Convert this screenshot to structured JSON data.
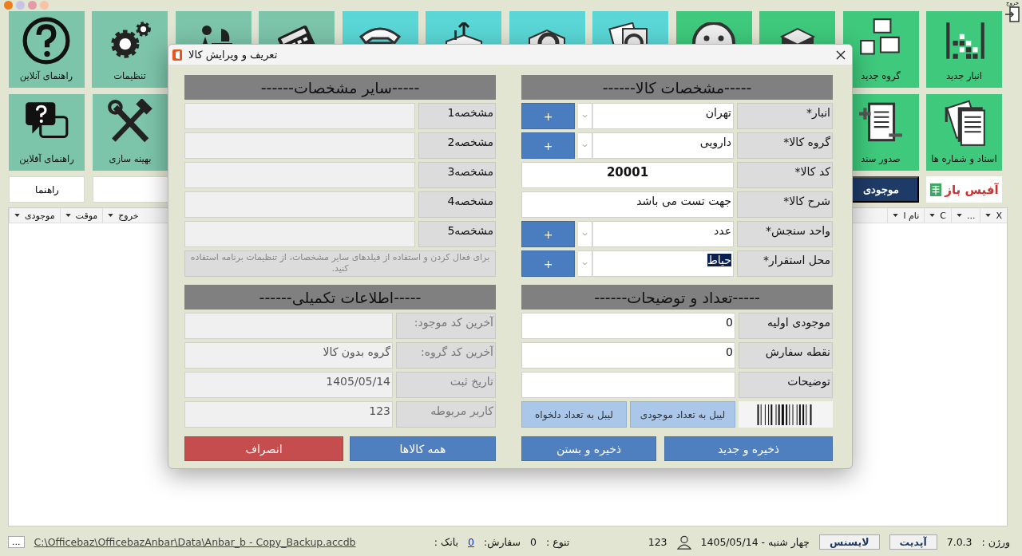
{
  "window_dots": [
    {
      "color": "#f07c1c"
    },
    {
      "color": "#c9c3e8"
    },
    {
      "color": "#e59aa8"
    },
    {
      "color": "#f6c3a8"
    }
  ],
  "exit": {
    "label": "خروج"
  },
  "top_tiles": [
    {
      "label": "انبار جدید",
      "color": "#3ec97c"
    },
    {
      "label": "گروه جدید",
      "color": "#3ec97c"
    },
    {
      "color": "#3ec97c"
    },
    {
      "color": "#3ec97c"
    },
    {
      "color": "#5ad6d6"
    },
    {
      "color": "#5ad6d6"
    },
    {
      "color": "#5ad6d6"
    },
    {
      "color": "#5ad6d6"
    },
    {
      "color": "#7cc4aa"
    },
    {
      "color": "#7cc4aa"
    },
    {
      "label": "تنظیمات",
      "color": "#7cc4aa"
    },
    {
      "label": "راهنمای آنلاین",
      "color": "#7cc4aa"
    }
  ],
  "second_row": {
    "right": [
      {
        "label": "اسناد و شماره ها",
        "color": "#3ec97c"
      },
      {
        "label": "صدور سند",
        "color": "#3ec97c"
      }
    ],
    "left": [
      {
        "label": "بهینه سازی",
        "color": "#7cc4aa"
      },
      {
        "label": "راهنمای آفلاین",
        "color": "#7cc4aa"
      }
    ]
  },
  "third_row": {
    "logo": "آفیس باز",
    "stock_button": "موجودی",
    "help_button": "راهنما"
  },
  "grid_header": {
    "right_columns": [
      "X",
      "...",
      "C",
      "نام ا"
    ],
    "left_columns": [
      "خروج",
      "موقت",
      "موجودی"
    ]
  },
  "dialog": {
    "title": "تعریف و ویرایش کالا",
    "sections": [
      {
        "title": "-----مشخصات کالا------",
        "rows": [
          {
            "kind": "combo",
            "label": "انبار*",
            "value": "تهران",
            "highlighted": false,
            "button": "+"
          },
          {
            "kind": "combo",
            "label": "گروه کالا*",
            "value": "دارویی",
            "highlighted": false,
            "button": "+"
          },
          {
            "kind": "code",
            "label": "کد کالا*",
            "value": "20001"
          },
          {
            "kind": "text",
            "label": "شرح کالا*",
            "value": "جهت تست می باشد",
            "disabled": false
          },
          {
            "kind": "combo",
            "label": "واحد سنجش*",
            "value": "عدد",
            "highlighted": false,
            "button": "+"
          },
          {
            "kind": "combo",
            "label": "محل استقرار*",
            "value": "حیاط",
            "highlighted": true,
            "button": "+"
          }
        ]
      },
      {
        "title": "-----سایر مشخصات------",
        "rows": [
          {
            "kind": "text",
            "label": "مشخصه1",
            "disabled": true
          },
          {
            "kind": "text",
            "label": "مشخصه2",
            "disabled": true
          },
          {
            "kind": "text",
            "label": "مشخصه3",
            "disabled": true
          },
          {
            "kind": "text",
            "label": "مشخصه4",
            "disabled": true
          },
          {
            "kind": "text",
            "label": "مشخصه5",
            "disabled": true
          },
          {
            "kind": "note",
            "text": "برای فعال کردن و استفاده از فیلدهای سایر مشخصات، از تنظیمات برنامه استفاده کنید."
          }
        ]
      },
      {
        "title": "-----تعداد و توضیحات------",
        "rows": [
          {
            "kind": "text",
            "label": "موجودی اولیه",
            "value": "0",
            "disabled": false
          },
          {
            "kind": "text",
            "label": "نقطه سفارش",
            "value": "0",
            "disabled": false
          },
          {
            "kind": "text",
            "label": "توضیحات",
            "disabled": false
          },
          {
            "kind": "label_buttons",
            "buttons": [
              "لیبل به تعداد موجودی",
              "لیبل به تعداد دلخواه"
            ]
          }
        ]
      },
      {
        "title": "-----اطلاعات تکمیلی------",
        "rows": [
          {
            "kind": "text",
            "label": "آخرین کد موجود:",
            "disabled": true
          },
          {
            "kind": "text",
            "label": "آخرین کد  گروه:",
            "value": "گروه بدون کالا",
            "disabled": true
          },
          {
            "kind": "text",
            "label": "تاریخ ثبت",
            "value": "1405/05/14",
            "disabled": true
          },
          {
            "kind": "text",
            "label": "کاربر مربوطه",
            "value": "123",
            "disabled": true
          }
        ]
      }
    ],
    "buttons": [
      {
        "label": "ذخیره و جدید",
        "kind": "primary"
      },
      {
        "label": "ذخیره و بستن",
        "kind": "primary"
      },
      {
        "label": "همه کالاها",
        "kind": "primary"
      },
      {
        "label": "انصراف",
        "kind": "danger"
      }
    ]
  },
  "status_bar": {
    "version_label": "ورژن :",
    "version": "7.0.3",
    "update_button": "آپدیت",
    "license_button": "لایسنس",
    "date": "چهار شنبه - 1405/05/14",
    "user": "123",
    "variety_label": "تنوع :",
    "variety": "0",
    "orders_label": "سفارش:",
    "orders": "0",
    "bank_label": "بانک :",
    "path": "C:\\Officebaz\\OfficebazAnbar\\Data\\Anbar_b - Copy_Backup.accdb",
    "more_button": "..."
  }
}
